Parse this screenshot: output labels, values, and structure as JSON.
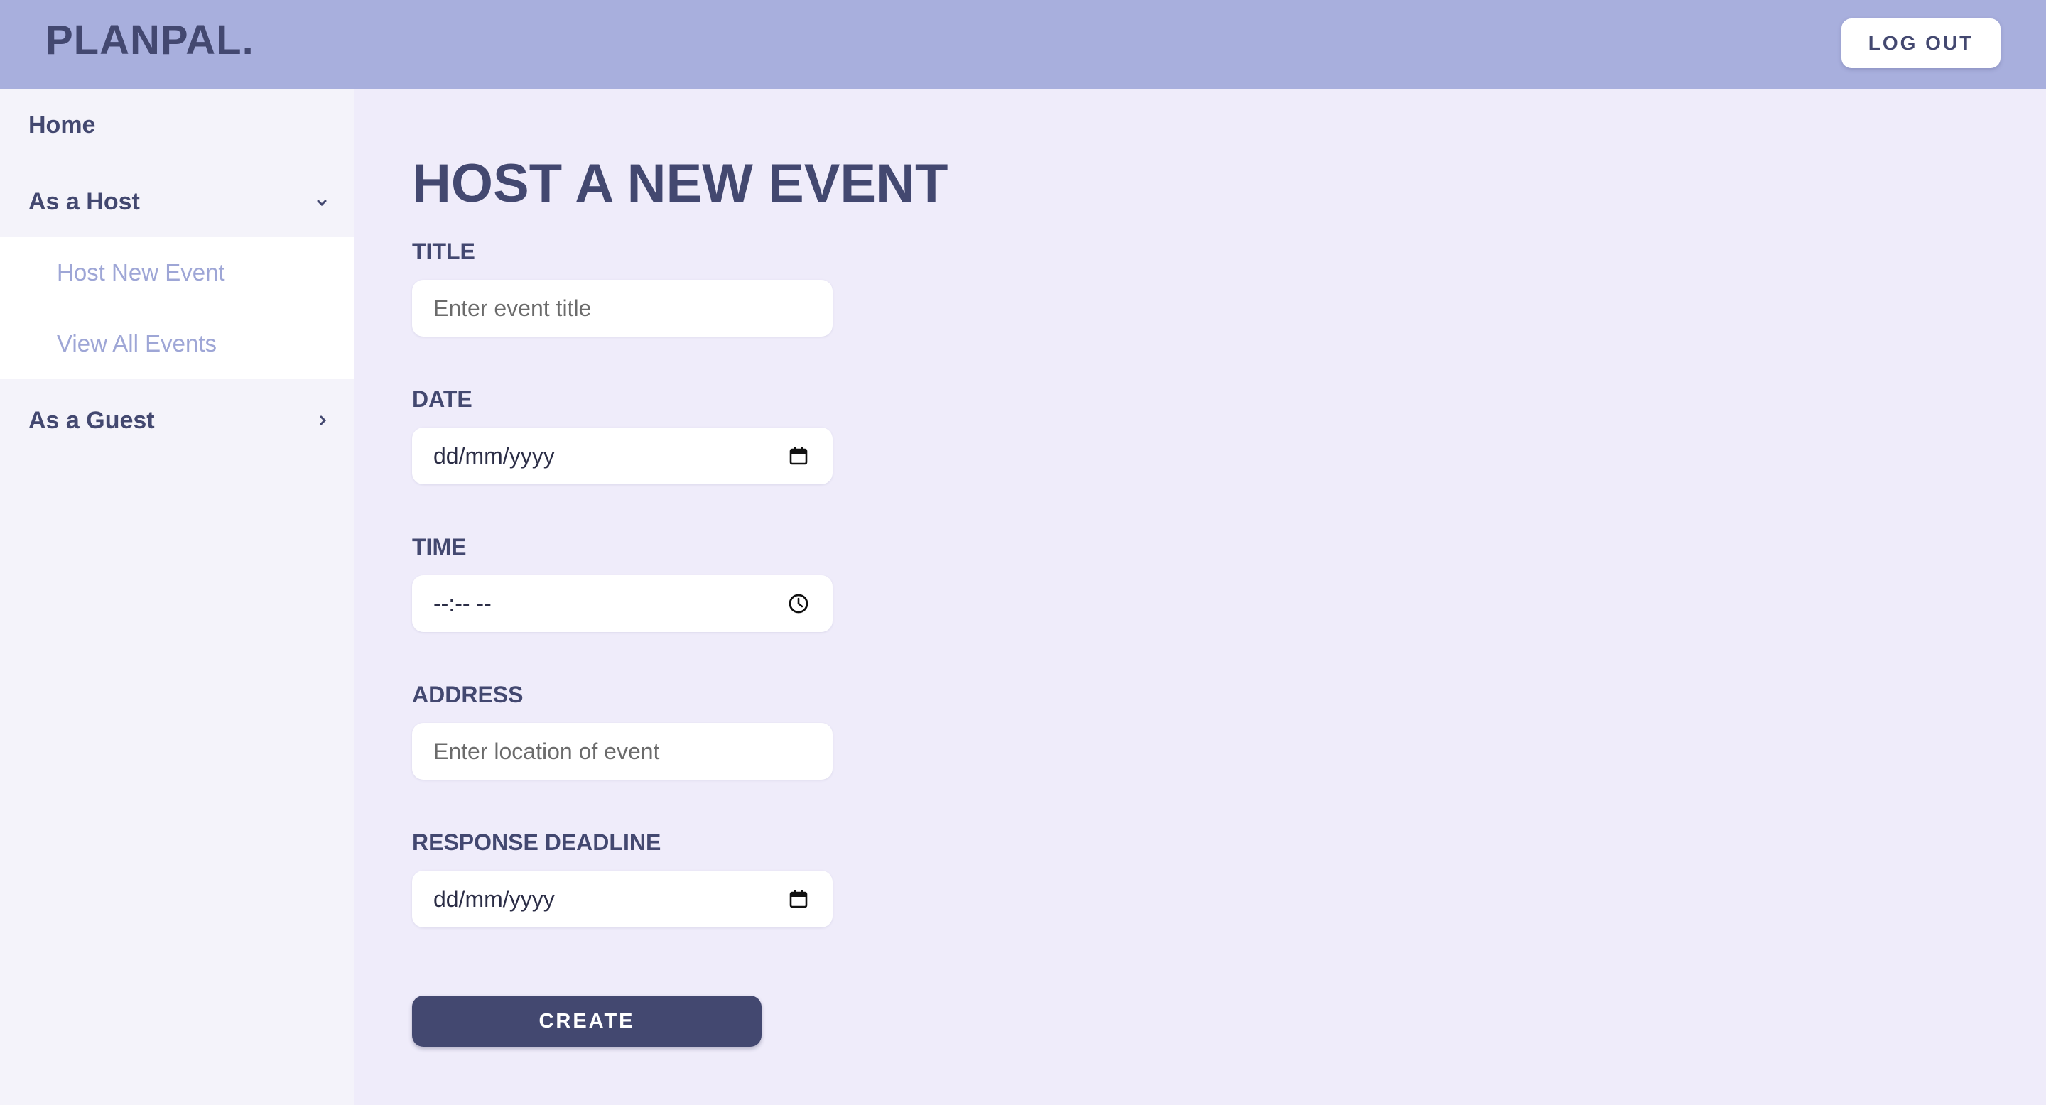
{
  "header": {
    "logo": "PLANPAL.",
    "logout_label": "LOG OUT"
  },
  "sidebar": {
    "home": "Home",
    "host_group": {
      "label": "As a Host",
      "expanded": true,
      "icon": "chevron-down-icon"
    },
    "host_items": [
      "Host New Event",
      "View All Events"
    ],
    "guest_group": {
      "label": "As a Guest",
      "expanded": false,
      "icon": "chevron-right-icon"
    }
  },
  "form": {
    "title": "HOST A NEW EVENT",
    "fields": {
      "title": {
        "label": "TITLE",
        "placeholder": "Enter event title"
      },
      "date": {
        "label": "DATE",
        "placeholder": "dd/mm/yyyy",
        "icon": "calendar-icon"
      },
      "time": {
        "label": "TIME",
        "placeholder": "--:-- --",
        "icon": "clock-icon"
      },
      "address": {
        "label": "ADDRESS",
        "placeholder": "Enter location of event"
      },
      "deadline": {
        "label": "RESPONSE DEADLINE",
        "placeholder": "dd/mm/yyyy",
        "icon": "calendar-icon"
      }
    },
    "submit_label": "CREATE"
  },
  "colors": {
    "header_bg": "#a8afdd",
    "accent": "#434870",
    "page_bg": "#efecfa",
    "sub_item_text": "#9ea6d6"
  }
}
